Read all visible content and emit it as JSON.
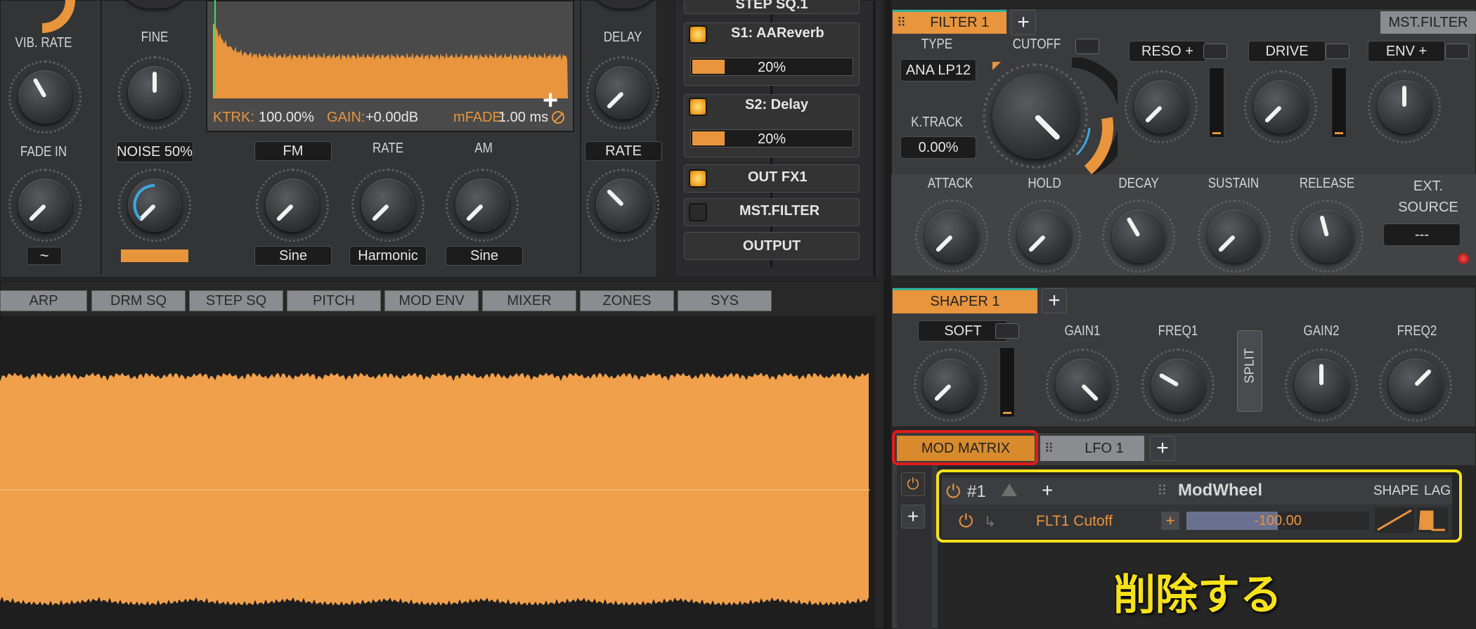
{
  "left_panel": {
    "vib_rate": "VIB. RATE",
    "fine": "FINE",
    "fade_in": "FADE IN",
    "noise": "NOISE 50%",
    "delay": "DELAY",
    "rate": "RATE",
    "fm": "FM",
    "rate2": "RATE",
    "am": "AM",
    "fm_shape": "Sine",
    "rate_shape": "Harmonic",
    "am_shape": "Sine",
    "wave_icon": "~"
  },
  "wave_display": {
    "ktrk_label": "KTRK:",
    "ktrk_value": "100.00%",
    "gain_label": "GAIN:",
    "gain_value": "+0.00dB",
    "mfade_label": "mFADE:",
    "mfade_value": "1.00 ms"
  },
  "fx_chain": {
    "top_cut": "STEP SQ.1",
    "s1_label": "S1: AAReverb",
    "s1_value": "20%",
    "s1_fill": 0.2,
    "s2_label": "S2: Delay",
    "s2_value": "20%",
    "s2_fill": 0.2,
    "out_fx1": "OUT FX1",
    "mst_filter": "MST.FILTER",
    "output": "OUTPUT"
  },
  "filter": {
    "tab": "FILTER 1",
    "mst_filter_btn": "MST.FILTER",
    "type_label": "TYPE",
    "type_value": "ANA LP12",
    "cutoff": "CUTOFF",
    "reso": "RESO +",
    "drive": "DRIVE",
    "env": "ENV +",
    "ktrack_label": "K.TRACK",
    "ktrack_value": "0.00%",
    "attack": "ATTACK",
    "hold": "HOLD",
    "decay": "DECAY",
    "sustain": "SUSTAIN",
    "release": "RELEASE",
    "ext_source": "EXT. SOURCE",
    "ext_value": "---"
  },
  "tabs": [
    "ARP",
    "DRM SQ",
    "STEP SQ",
    "PITCH",
    "MOD ENV",
    "MIXER",
    "ZONES",
    "SYS"
  ],
  "shaper": {
    "tab": "SHAPER 1",
    "soft": "SOFT",
    "gain1": "GAIN1",
    "freq1": "FREQ1",
    "split": "SPLIT",
    "gain2": "GAIN2",
    "freq2": "FREQ2"
  },
  "mod_matrix": {
    "tab": "MOD MATRIX",
    "lfo_tab": "LFO 1",
    "slot": "#1",
    "source": "ModWheel",
    "shape": "SHAPE",
    "lag": "LAG",
    "target": "FLT1 Cutoff",
    "amount": "-100.00"
  },
  "annotation": {
    "text": "削除する",
    "highlight_red": "#e31b1b",
    "highlight_yellow": "#f6e21a"
  },
  "colors": {
    "accent_orange": "#e8953d",
    "panel": "#333436",
    "bg": "#262626",
    "tab_gray": "#8a8c90"
  }
}
